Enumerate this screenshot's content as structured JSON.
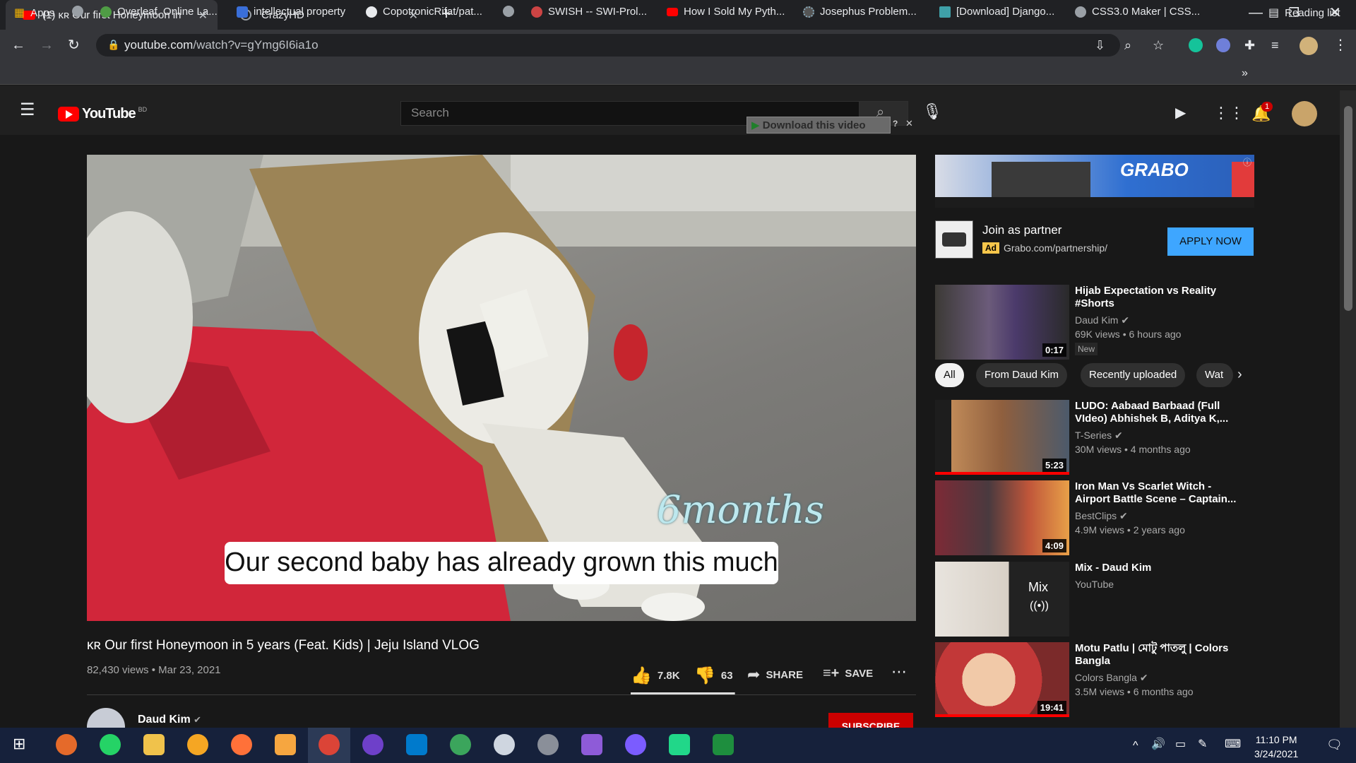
{
  "browser": {
    "tabs": [
      {
        "label": "(1) ᴋʀ Our first Honeymoon in",
        "active": true
      },
      {
        "label": "CrazyHD",
        "active": false
      }
    ],
    "url_host": "youtube.com",
    "url_path": "/watch?v=gYmg6I6ia1o",
    "bookmarks": [
      "Apps",
      "Overleaf, Online La...",
      "intellectual property",
      "CopotronicRifat/pat...",
      "SWISH -- SWI-Prol...",
      "How I Sold My Pyth...",
      "Josephus Problem...",
      "[Download] Django...",
      "CSS3.0 Maker | CSS...",
      "Reading list"
    ]
  },
  "youtube": {
    "logo": "YouTube",
    "region": "BD",
    "search_placeholder": "Search",
    "download_label": "Download this video",
    "notification_count": "1"
  },
  "video": {
    "caption": "Our second baby has already grown this much",
    "overlay_text": "6months",
    "title": "ᴋʀ Our first Honeymoon in 5 years (Feat. Kids) | Jeju Island VLOG",
    "meta": "82,430 views • Mar 23, 2021",
    "likes": "7.8K",
    "dislikes": "63",
    "share_label": "SHARE",
    "save_label": "SAVE",
    "like_ratio": 0.99,
    "channel": "Daud Kim",
    "subscribe_label": "SUBSCRIBE"
  },
  "ad": {
    "banner_brand": "GRABO",
    "title": "Join as partner",
    "badge": "Ad",
    "url": "Grabo.com/partnership/",
    "cta": "APPLY NOW"
  },
  "chips": [
    "All",
    "From Daud Kim",
    "Recently uploaded",
    "Wat"
  ],
  "related": [
    {
      "title": "Hijab Expectation vs Reality #Shorts",
      "channel": "Daud Kim",
      "meta": "69K views • 6 hours ago",
      "badge": "New",
      "duration": "0:17"
    },
    {
      "title": "LUDO: Aabaad Barbaad (Full VIdeo) Abhishek B, Aditya K,...",
      "channel": "T-Series",
      "meta": "30M views • 4 months ago",
      "duration": "5:23"
    },
    {
      "title": "Iron Man Vs Scarlet Witch - Airport Battle Scene – Captain...",
      "channel": "BestClips",
      "meta": "4.9M views • 2 years ago",
      "duration": "4:09"
    },
    {
      "title": "Mix - Daud Kim",
      "channel": "YouTube",
      "mix_label": "Mix"
    },
    {
      "title": "Motu Patlu | মোটু পাতলু | Colors Bangla",
      "channel": "Colors Bangla",
      "meta": "3.5M views • 6 months ago",
      "duration": "19:41"
    }
  ],
  "taskbar": {
    "time": "11:10 PM",
    "date": "3/24/2021"
  }
}
